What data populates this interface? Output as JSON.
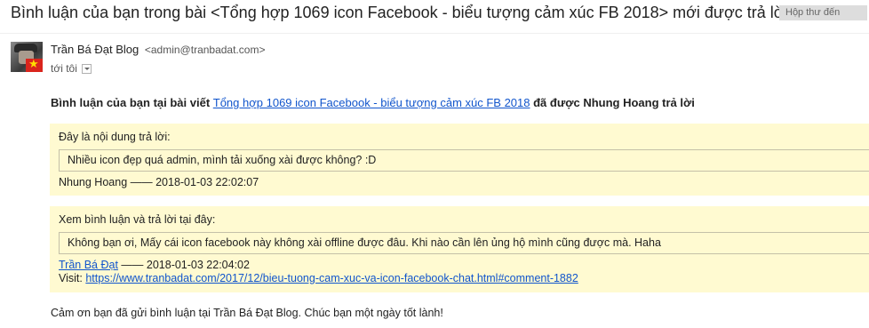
{
  "email": {
    "subject": "Bình luận của bạn trong bài <Tổng hợp 1069 icon Facebook - biểu tượng cảm xúc FB 2018> mới được trả lời",
    "inbox_badge": "Hộp thư đến",
    "sender": {
      "name": "Trần Bá Đạt Blog",
      "email": "<admin@tranbadat.com>"
    },
    "to_label": "tới tôi"
  },
  "body": {
    "intro_prefix": "Bình luận của bạn tại bài viết ",
    "intro_link": "Tổng hợp 1069 icon Facebook - biểu tượng cảm xúc FB 2018",
    "intro_suffix": " đã được Nhung Hoang trả lời",
    "original_comment": {
      "label": "Đây là nội dung trả lời:",
      "text": "Nhiều icon đẹp quá admin, mình tải xuống xài được không? :D",
      "meta": "Nhung Hoang —— 2018-01-03 22:02:07"
    },
    "reply": {
      "label": "Xem bình luận và trả lời tại đây:",
      "text": "Không bạn ơi, Mấy cái icon facebook này không xài offline được đâu. Khi nào cần lên ủng hộ mình cũng được mà. Haha",
      "author_link": "Trần Bá Đạt",
      "meta_suffix": " —— 2018-01-03 22:04:02",
      "visit_label": "Visit: ",
      "visit_url": "https://www.tranbadat.com/2017/12/bieu-tuong-cam-xuc-va-icon-facebook-chat.html#comment-1882"
    },
    "thanks": "Cảm ơn bạn đã gửi bình luận tại Trần Bá Đạt Blog. Chúc bạn một ngày tốt lành!"
  },
  "colors": {
    "link": "#1155cc",
    "box_bg": "#fffad1",
    "badge_bg": "#dddddd"
  },
  "icons": {
    "dropdown": "chevron-down-icon",
    "avatar": "avatar"
  }
}
